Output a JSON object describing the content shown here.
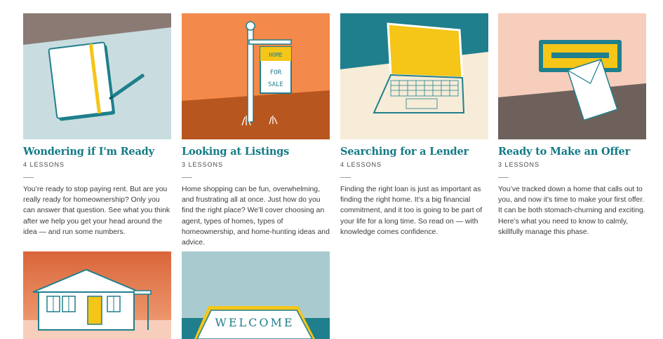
{
  "cards": [
    {
      "title": "Wondering if I'm Ready",
      "lessons": "4 LESSONS",
      "description": "You’re ready to stop paying rent. But are you really ready for homeownership? Only you can answer that question. See what you think after we help you get your head around the idea — and run some numbers."
    },
    {
      "title": "Looking at Listings",
      "lessons": "3 LESSONS",
      "description": "Home shopping can be fun, overwhelming, and frustrating all at once. Just how do you find the right place? We’ll cover choosing an agent, types of homes, types of homeownership, and home-hunting ideas and advice.",
      "sign_line1": "HOME",
      "sign_line2": "FOR",
      "sign_line3": "SALE"
    },
    {
      "title": "Searching for a Lender",
      "lessons": "4 LESSONS",
      "description": "Finding the right loan is just as important as finding the right home. It’s a big financial commitment, and it too is going to be part of your life for a long time. So read on — with knowledge comes confidence."
    },
    {
      "title": "Ready to Make an Offer",
      "lessons": "3 LESSONS",
      "description": "You’ve tracked down a home that calls out to you, and now it’s time to make your first offer. It can be both stomach-churning and exciting. Here’s what you need to know to calmly, skillfully manage this phase."
    },
    {
      "mat_text": "WELCOME"
    }
  ],
  "colors": {
    "title": "#137a86",
    "teal": "#1f7f8c",
    "yellow": "#f5c518",
    "orange": "#f3894a",
    "rust": "#b8561f",
    "pale_blue": "#c9dde0",
    "taupe": "#8a7a73",
    "pink": "#f7cdbb",
    "brown": "#6e615c"
  },
  "icons": [
    "notebook-illustration",
    "for-sale-sign-illustration",
    "laptop-illustration",
    "mailbox-letter-illustration",
    "house-illustration",
    "welcome-mat-illustration"
  ]
}
